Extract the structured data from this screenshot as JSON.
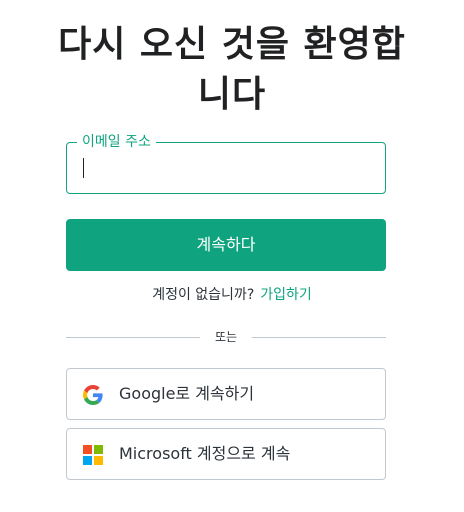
{
  "header": {
    "title_line1": "다시 오신 것을 환영합",
    "title_line2": "니다"
  },
  "email_field": {
    "label": "이메일 주소",
    "value": ""
  },
  "continue_button": {
    "label": "계속하다"
  },
  "signup": {
    "prompt": "계정이 없습니까?",
    "link_label": "가입하기"
  },
  "divider": {
    "text": "또는"
  },
  "social": {
    "google_label": "Google로 계속하기",
    "google_icon": "google-icon",
    "microsoft_label": "Microsoft 계정으로 계속",
    "microsoft_icon": "microsoft-icon"
  },
  "colors": {
    "accent": "#10a37f",
    "border": "#c2c8d0",
    "text": "#2d333a",
    "google_blue": "#4285F4",
    "google_green": "#34A853",
    "google_yellow": "#FBBC05",
    "google_red": "#EA4335",
    "ms_red": "#F25022",
    "ms_green": "#7FBA00",
    "ms_blue": "#00A4EF",
    "ms_yellow": "#FFB900"
  }
}
